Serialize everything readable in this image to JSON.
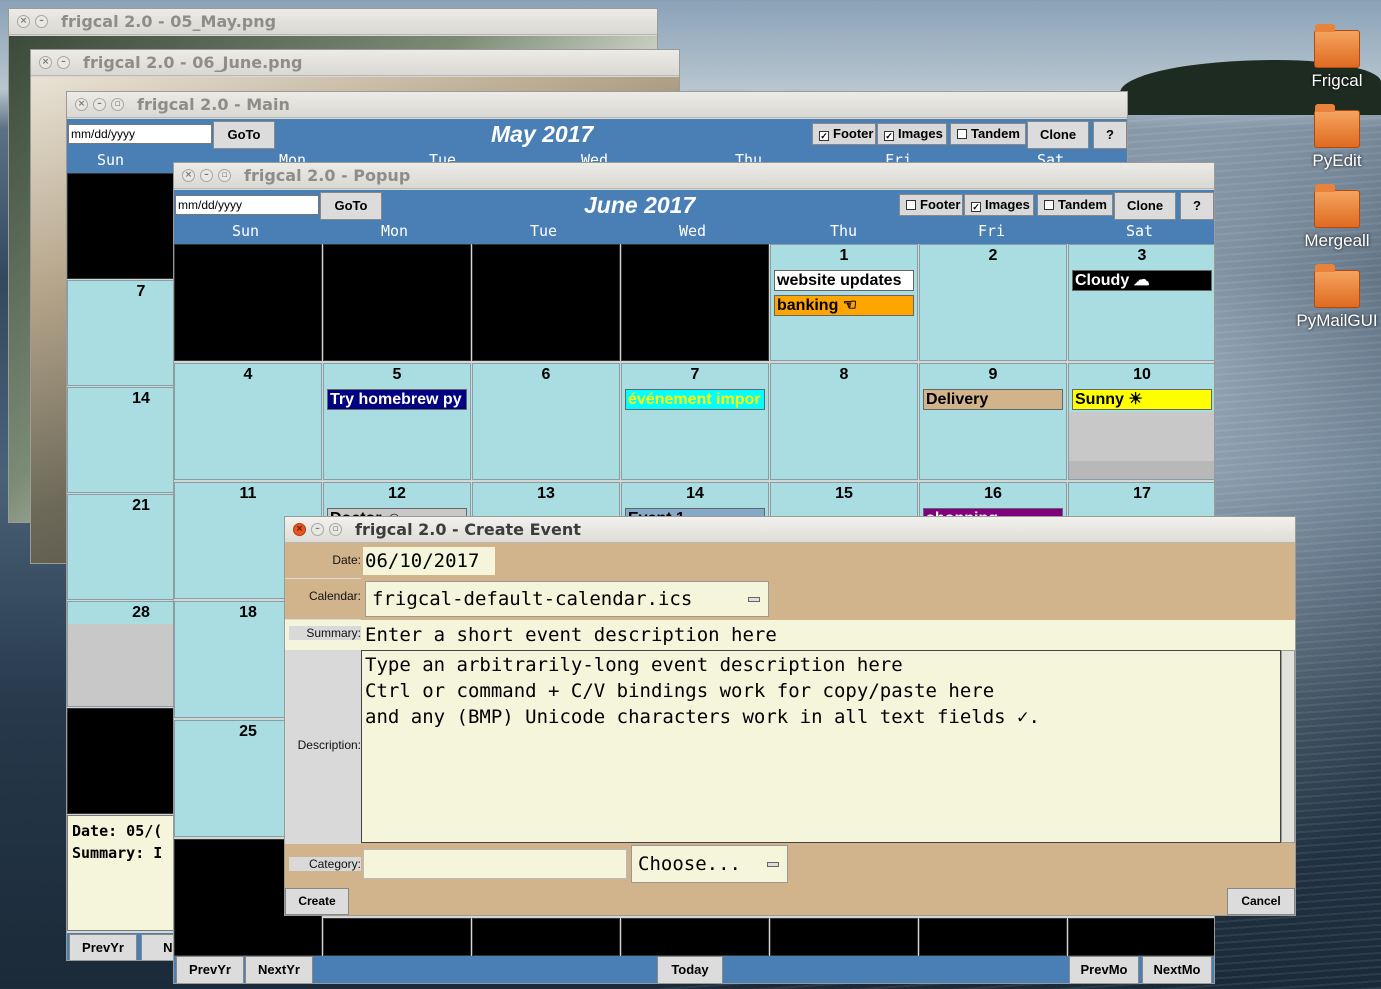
{
  "desktop": {
    "icons": [
      {
        "label": "Frigcal"
      },
      {
        "label": "PyEdit"
      },
      {
        "label": "Mergeall"
      },
      {
        "label": "PyMailGUI"
      }
    ]
  },
  "win_may_img": {
    "title": "frigcal 2.0 - 05_May.png"
  },
  "win_june_img": {
    "title": "frigcal 2.0 - 06_June.png"
  },
  "main": {
    "title": "frigcal 2.0 - Main",
    "date_placeholder": "mm/dd/yyyy",
    "goto": "GoTo",
    "month": "May 2017",
    "footer": "Footer",
    "images": "Images",
    "tandem": "Tandem",
    "clone": "Clone",
    "help": "?",
    "days": [
      "Sun",
      "Mon",
      "Tue",
      "Wed",
      "Thu",
      "Fri",
      "Sat"
    ],
    "sun_nums": [
      "7",
      "14",
      "21",
      "28"
    ],
    "footer_date": "Date: 05/(",
    "footer_summary": "Summary: I",
    "prevyr": "PrevYr",
    "nextyr": "Nex"
  },
  "popup": {
    "title": "frigcal 2.0 - Popup",
    "date_placeholder": "mm/dd/yyyy",
    "goto": "GoTo",
    "month": "June 2017",
    "footer": "Footer",
    "images": "Images",
    "tandem": "Tandem",
    "clone": "Clone",
    "help": "?",
    "days": [
      "Sun",
      "Mon",
      "Tue",
      "Wed",
      "Thu",
      "Fri",
      "Sat"
    ],
    "nums": {
      "d1": "1",
      "d2": "2",
      "d3": "3",
      "d4": "4",
      "d5": "5",
      "d6": "6",
      "d7": "7",
      "d8": "8",
      "d9": "9",
      "d10": "10",
      "d11": "11",
      "d12": "12",
      "d13": "13",
      "d14": "14",
      "d15": "15",
      "d16": "16",
      "d17": "17",
      "d18": "18",
      "d25": "25"
    },
    "events": {
      "website": "website updates",
      "banking": "banking ☜",
      "cloudy": "Cloudy ☁",
      "homebrew": "Try homebrew py",
      "evenement": "événement impor",
      "delivery": "Delivery",
      "sunny": "Sunny ☀",
      "doctor": "Doctor ☺",
      "event1": "Event 1",
      "shopping": "shopping"
    },
    "prevyr": "PrevYr",
    "nextyr": "NextYr",
    "today": "Today",
    "prevmo": "PrevMo",
    "nextmo": "NextMo",
    "colors": {
      "header": "#4a7fb5",
      "cell": "#a9dde1",
      "banking": "#ffa500",
      "homebrew": "#000080",
      "evenement": "#00ffff",
      "delivery": "#d2b48c",
      "sunny": "#ffff00",
      "shopping": "#800080"
    }
  },
  "create": {
    "title": "frigcal 2.0 - Create Event",
    "date_label": "Date:",
    "date_value": "06/10/2017",
    "calendar_label": "Calendar:",
    "calendar_value": "frigcal-default-calendar.ics",
    "summary_label": "Summary:",
    "summary_value": "Enter a short event description here",
    "description_label": "Description:",
    "desc_line1": "Type an arbitrarily-long event description here",
    "desc_line2": "Ctrl or command + C/V bindings work for copy/paste here",
    "desc_line3": "and any (BMP) Unicode characters work in all text fields ✓.",
    "category_label": "Category:",
    "category_value": "",
    "choose": "Choose...",
    "create_btn": "Create",
    "cancel_btn": "Cancel",
    "colors": {
      "bg": "#d2b48c",
      "field": "#f5f5dc"
    }
  }
}
